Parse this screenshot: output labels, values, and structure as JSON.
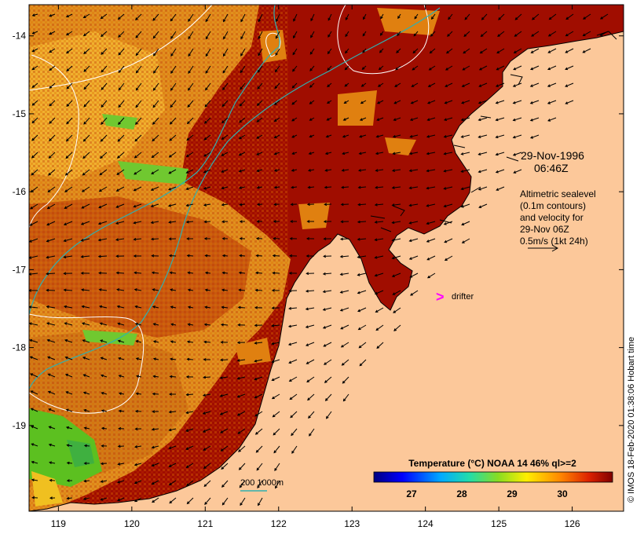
{
  "map": {
    "lon_range": [
      118.6,
      126.7
    ],
    "lat_range": [
      -20.1,
      -13.6
    ],
    "x_ticks": [
      "119",
      "120",
      "121",
      "122",
      "123",
      "124",
      "125",
      "126"
    ],
    "y_ticks": [
      "-14",
      "-15",
      "-16",
      "-17",
      "-18",
      "-19"
    ],
    "date_line1": "29-Nov-1996",
    "date_line2": "06:46Z",
    "alti_lines": [
      "Altimetric sealevel",
      "(0.1m contours)",
      "and velocity for",
      "29-Nov 06Z",
      "0.5m/s (1kt 24h)"
    ],
    "drifter_label": "drifter",
    "drifter_marker": ">",
    "bathy_label": "200  1000m",
    "colorbar_title": "Temperature (°C) NOAA 14 46% ql>=2",
    "colorbar_ticks": [
      "27",
      "28",
      "29",
      "30"
    ],
    "copyright": "© IMOS 18-Feb-2020 01:38:06 Hobart time",
    "colors": {
      "land": "#fcc89a",
      "warm_sea": "#a00d00",
      "bathy": "#2fb0b0",
      "drifter": "#ff00ff"
    }
  }
}
